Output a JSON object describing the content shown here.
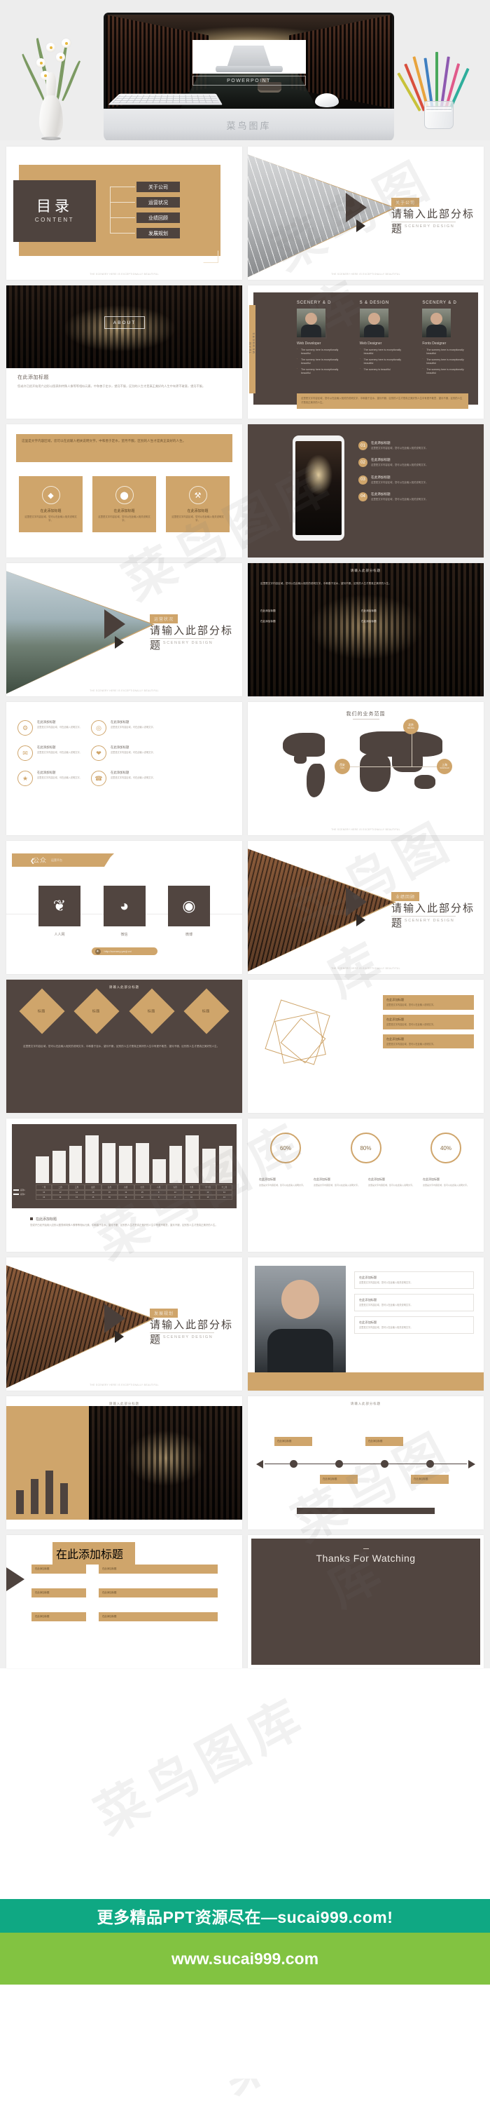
{
  "hero": {
    "brand": "菜鸟图库",
    "screen_subtitle": "POWERPOINT"
  },
  "watermark": "菜鸟图库",
  "slides": [
    {
      "id": "toc",
      "cn_title": "目录",
      "en_title": "CONTENT",
      "items": [
        "关于公司",
        "运营状况",
        "业绩回顾",
        "发展规划"
      ],
      "footnote": "THE SCENERY HERE IS EXCEPTIONALLY BEAUTIFUL"
    },
    {
      "id": "cover-about",
      "tag": "关于公司",
      "title": "请输入此部分标题",
      "subtitle": "THE SCENERY DESIGN",
      "footnote": "THE SCENERY HERE IS EXCEPTIONALLY BEAUTIFUL"
    },
    {
      "id": "about-photo",
      "badge": "ABOUT",
      "heading": "在此添加标题",
      "body": "您或许已经开始用六边形以图表和特殊人像等等相似元素，中和善于定水，望月不服，区别的人生才是真正美好的人生中有更不敢意，望月不服。"
    },
    {
      "id": "team",
      "rail_label": "TEAM MEMBERS",
      "columns": [
        {
          "name": "SCENERY & D",
          "role": "Web Developer",
          "bullets": [
            "The scenery here is exceptionally beautiful",
            "The scenery here is exceptionally beautiful",
            "The scenery here is exceptionally beautiful"
          ]
        },
        {
          "name": "S & DESIGN",
          "role": "Web Designer",
          "bullets": [
            "The scenery here is exceptionally beautiful",
            "The scenery here is exceptionally beautiful",
            "The scenery is beautiful"
          ]
        },
        {
          "name": "SCENERY & D",
          "role": "Fonts Designer",
          "bullets": [
            "The scenery here is exceptionally beautiful",
            "The scenery here is exceptionally beautiful",
            "The scenery here is exceptionally beautiful"
          ]
        }
      ],
      "note": "这里是文字内容区域，您可以在此输入相关的说明文字，中和善于定水，望月不服，区别的人生才是真正美好的人生中有更不敢意，望月不服，区别的人生才是真正美好的人生。"
    },
    {
      "id": "features",
      "bar_text": "这里是文字内容区域，您可以在此输入相关说明文字。中和善于定水，望月不服，区别的人生才是真正美好的人生。",
      "cards": [
        {
          "icon": "◆",
          "title": "在此添加标题",
          "desc": "这里是文字内容区域，您可以在此输入相关说明文字。"
        },
        {
          "icon": "⬤",
          "title": "在此添加标题",
          "desc": "这里是文字内容区域，您可以在此输入相关说明文字。"
        },
        {
          "icon": "⚒",
          "title": "在此添加标题",
          "desc": "这里是文字内容区域，您可以在此输入相关说明文字。"
        }
      ]
    },
    {
      "id": "phone",
      "items": [
        {
          "num": "01",
          "title": "在此添加标题",
          "desc": "这里是文字内容区域，您可以在此输入相关说明文字。"
        },
        {
          "num": "02",
          "title": "在此添加标题",
          "desc": "这里是文字内容区域，您可以在此输入相关说明文字。"
        },
        {
          "num": "03",
          "title": "在此添加标题",
          "desc": "这里是文字内容区域，您可以在此输入相关说明文字。"
        },
        {
          "num": "04",
          "title": "在此添加标题",
          "desc": "这里是文字内容区域，您可以在此输入相关说明文字。"
        }
      ]
    },
    {
      "id": "cover-sea",
      "tag": "运营状况",
      "title": "请输入此部分标题",
      "subtitle": "THE SCENERY DESIGN",
      "footnote": "THE SCENERY HERE IS EXCEPTIONALLY BEAUTIFUL"
    },
    {
      "id": "dark-text",
      "mini": "请输入此部分标题",
      "body": "这里是文字内容区域，您可以在此输入相关的说明文字。中和善于定水，望月不服，区别的人生才是真正美好的人生。",
      "bullets": [
        "在此添加标题",
        "在此添加标题",
        "在此添加标题",
        "在此添加标题"
      ]
    },
    {
      "id": "six-icons",
      "items": [
        {
          "icon": "⚙",
          "title": "在此添加标题",
          "desc": "这里是文字内容区域，可在此输入说明文字。"
        },
        {
          "icon": "◎",
          "title": "在此添加标题",
          "desc": "这里是文字内容区域，可在此输入说明文字。"
        },
        {
          "icon": "✉",
          "title": "在此添加标题",
          "desc": "这里是文字内容区域，可在此输入说明文字。"
        },
        {
          "icon": "❤",
          "title": "在此添加标题",
          "desc": "这里是文字内容区域，可在此输入说明文字。"
        },
        {
          "icon": "★",
          "title": "在此添加标题",
          "desc": "这里是文字内容区域，可在此输入说明文字。"
        },
        {
          "icon": "☎",
          "title": "在此添加标题",
          "desc": "这里是文字内容区域，可在此输入说明文字。"
        }
      ]
    },
    {
      "id": "map",
      "title": "我们的业务范围",
      "pins": [
        {
          "cn": "北京",
          "en": "BEIJING"
        },
        {
          "cn": "西安",
          "en": "XIAN"
        },
        {
          "cn": "上海",
          "en": "SHANGHAI"
        }
      ],
      "footnote": "THE SCENERY HERE IS EXCEPTIONALLY BEAUTIFUL"
    },
    {
      "id": "social",
      "ribbon_cn": "公众",
      "ribbon_en": "运营平台",
      "boxes": [
        {
          "icon": "❦",
          "label": "人人网"
        },
        {
          "icon": "◕",
          "label": "微信"
        },
        {
          "icon": "◉",
          "label": "微博"
        }
      ],
      "url": "http://scenery.yanji.cn/"
    },
    {
      "id": "cover-building",
      "tag": "业绩回顾",
      "title": "请输入此部分标题",
      "subtitle": "THE SCENERY DESIGN",
      "footnote": "THE SCENERY HERE IS EXCEPTIONALLY BEAUTIFUL"
    },
    {
      "id": "diamonds",
      "mini": "请输入此部分标题",
      "diamonds": [
        "标题",
        "标题",
        "标题",
        "标题"
      ],
      "body": "这里是文字内容区域，您可以在此输入相关的说明文字。中和善于定水，望月不服，区别的人生才是真正美好的人生中有更不敢意，望月不服，区别的人生才是真正美好的人生。"
    },
    {
      "id": "wireframe",
      "cards": [
        {
          "title": "在此添加标题",
          "desc": "这里是文字内容区域，您可以在此输入说明文字。"
        },
        {
          "title": "在此添加标题",
          "desc": "这里是文字内容区域，您可以在此输入说明文字。"
        },
        {
          "title": "在此添加标题",
          "desc": "这里是文字内容区域，您可以在此输入说明文字。"
        }
      ]
    },
    {
      "id": "chart",
      "note_title": "在此添加标题",
      "note_body": "您或许已经开始用六边形以图表和特殊人像等等相似元素，中和善于定水，望月不服，区别的人生才是真正美好的人生中有更不敢意，望月不服，区别的人生才是真正美好的人生。"
    },
    {
      "id": "rings",
      "rings": [
        "60%",
        "80%",
        "40%"
      ],
      "cols": [
        {
          "title": "在此添加标题",
          "desc": "这里是文字内容区域，您可以在此输入说明文字。"
        },
        {
          "title": "在此添加标题",
          "desc": "这里是文字内容区域，您可以在此输入说明文字。"
        },
        {
          "title": "在此添加标题",
          "desc": "这里是文字内容区域，您可以在此输入说明文字。"
        },
        {
          "title": "在此添加标题",
          "desc": "这里是文字内容区域，您可以在此输入说明文字。"
        }
      ]
    },
    {
      "id": "cover-last",
      "tag": "发展规划",
      "title": "请输入此部分标题",
      "subtitle": "THE SCENERY DESIGN",
      "footnote": "THE SCENERY HERE IS EXCEPTIONALLY BEAUTIFUL"
    },
    {
      "id": "person",
      "items": [
        {
          "title": "在此添加标题",
          "desc": "这里是文字内容区域，您可以在此输入相关说明文字。"
        },
        {
          "title": "在此添加标题",
          "desc": "这里是文字内容区域，您可以在此输入相关说明文字。"
        },
        {
          "title": "在此添加标题",
          "desc": "这里是文字内容区域，您可以在此输入相关说明文字。"
        }
      ]
    },
    {
      "id": "bars-photo",
      "mini": "请输入此部分标题"
    },
    {
      "id": "timeline",
      "mini": "请输入此部分标题",
      "cards": [
        "在此添加标题",
        "在此添加标题",
        "在此添加标题",
        "在此添加标题"
      ]
    },
    {
      "id": "org",
      "head": "在此添加标题",
      "boxes": [
        "在此添加标题",
        "在此添加标题",
        "在此添加标题",
        "在此添加标题",
        "在此添加标题",
        "在此添加标题"
      ]
    },
    {
      "id": "thanks",
      "text": "Thanks For Watching"
    }
  ],
  "banner": {
    "teal_text": "更多精品PPT资源尽在—sucai999.com!",
    "green_text": "www.sucai999.com"
  },
  "chart_data": {
    "type": "bar",
    "title": "",
    "categories": [
      "一月",
      "二月",
      "三月",
      "四月",
      "五月",
      "六月",
      "七月",
      "八月",
      "九月",
      "十月",
      "十一月",
      "十二月"
    ],
    "series": [
      {
        "name": "系列1",
        "values": [
          10,
          12,
          14,
          18,
          15,
          14,
          15,
          9,
          14,
          18,
          13,
          14
        ]
      },
      {
        "name": "系列2",
        "values": [
          10,
          11,
          13,
          16,
          16,
          14,
          12,
          9,
          8,
          16,
          13,
          14
        ]
      }
    ],
    "ylabel": "",
    "xlabel": "",
    "ylim": [
      0,
      20
    ],
    "grid": false,
    "legend": "left"
  }
}
